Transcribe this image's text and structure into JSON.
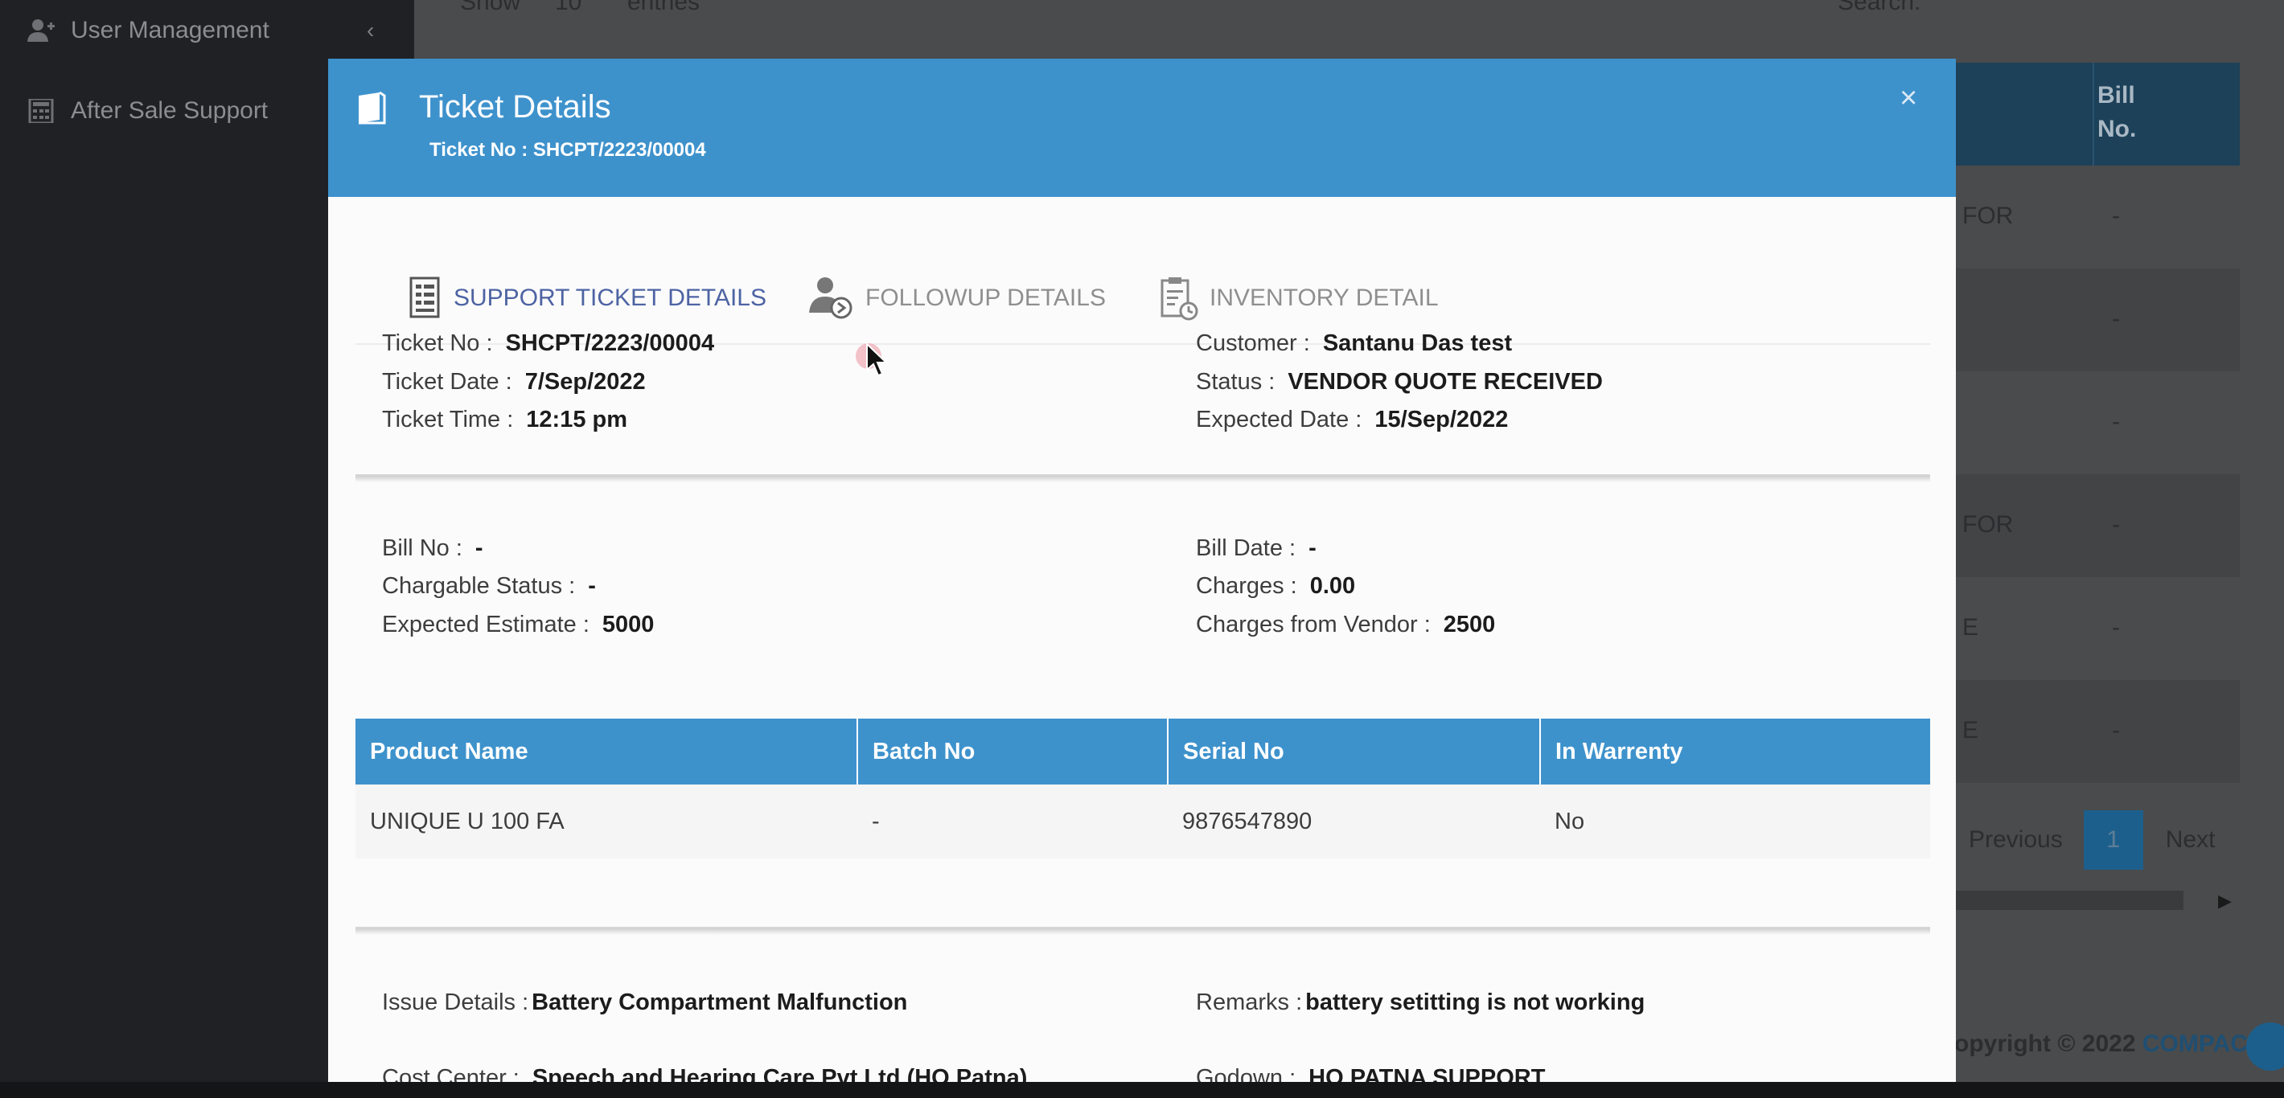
{
  "sidebar": {
    "items": [
      {
        "label": "User Management",
        "icon": "user-plus-icon"
      },
      {
        "label": "After Sale Support",
        "icon": "calculator-icon"
      }
    ]
  },
  "background": {
    "show_label": "Show",
    "length_value": "10",
    "entries_label": "entries",
    "search_label": "Search:",
    "col_header": "Bill\nNo.",
    "rows": [
      {
        "c1": "FOR",
        "c2": "-"
      },
      {
        "c1": "",
        "c2": "-"
      },
      {
        "c1": "",
        "c2": "-"
      },
      {
        "c1": "FOR",
        "c2": "-"
      },
      {
        "c1": "E",
        "c2": "-"
      },
      {
        "c1": "E",
        "c2": "-"
      }
    ],
    "pager": {
      "previous": "Previous",
      "page": "1",
      "next": "Next"
    },
    "footer": {
      "text": "opyright © 2022 ",
      "brand": "COMPACCT"
    }
  },
  "modal": {
    "title": "Ticket Details",
    "subtitle": "Ticket No : SHCPT/2223/00004",
    "close": "×",
    "tabs": [
      {
        "label": "SUPPORT TICKET DETAILS",
        "icon": "ticket-list-icon",
        "active": true
      },
      {
        "label": "FOLLOWUP DETAILS",
        "icon": "user-followup-icon",
        "active": false
      },
      {
        "label": "INVENTORY DETAIL",
        "icon": "clipboard-clock-icon",
        "active": false
      }
    ],
    "ticket": {
      "ticket_no_label": "Ticket No :",
      "ticket_no": "SHCPT/2223/00004",
      "ticket_date_label": "Ticket Date :",
      "ticket_date": "7/Sep/2022",
      "ticket_time_label": "Ticket Time :",
      "ticket_time": "12:15 pm",
      "customer_label": "Customer :",
      "customer": "Santanu Das test",
      "status_label": "Status :",
      "status": "VENDOR QUOTE RECEIVED",
      "expected_date_label": "Expected Date :",
      "expected_date": "15/Sep/2022"
    },
    "billing": {
      "bill_no_label": "Bill No :",
      "bill_no": "-",
      "chargable_label": "Chargable Status :",
      "chargable": "-",
      "estimate_label": "Expected Estimate :",
      "estimate": "5000",
      "bill_date_label": "Bill Date :",
      "bill_date": "-",
      "charges_label": "Charges :",
      "charges": "0.00",
      "vendor_charges_label": "Charges from Vendor :",
      "vendor_charges": "2500"
    },
    "products": {
      "headers": [
        "Product Name",
        "Batch No",
        "Serial No",
        "In Warrenty"
      ],
      "rows": [
        [
          "UNIQUE U 100 FA",
          "-",
          "9876547890",
          "No"
        ]
      ]
    },
    "issue": {
      "issue_label": "Issue Details :",
      "issue": "Battery Compartment Malfunction",
      "remarks_label": "Remarks :",
      "remarks": "battery setitting is not working",
      "cost_center_label": "Cost Center :",
      "cost_center": "Speech and Hearing Care Pvt Ltd (HQ Patna)",
      "godown_label": "Godown :",
      "godown": "HQ PATNA SUPPORT"
    }
  }
}
